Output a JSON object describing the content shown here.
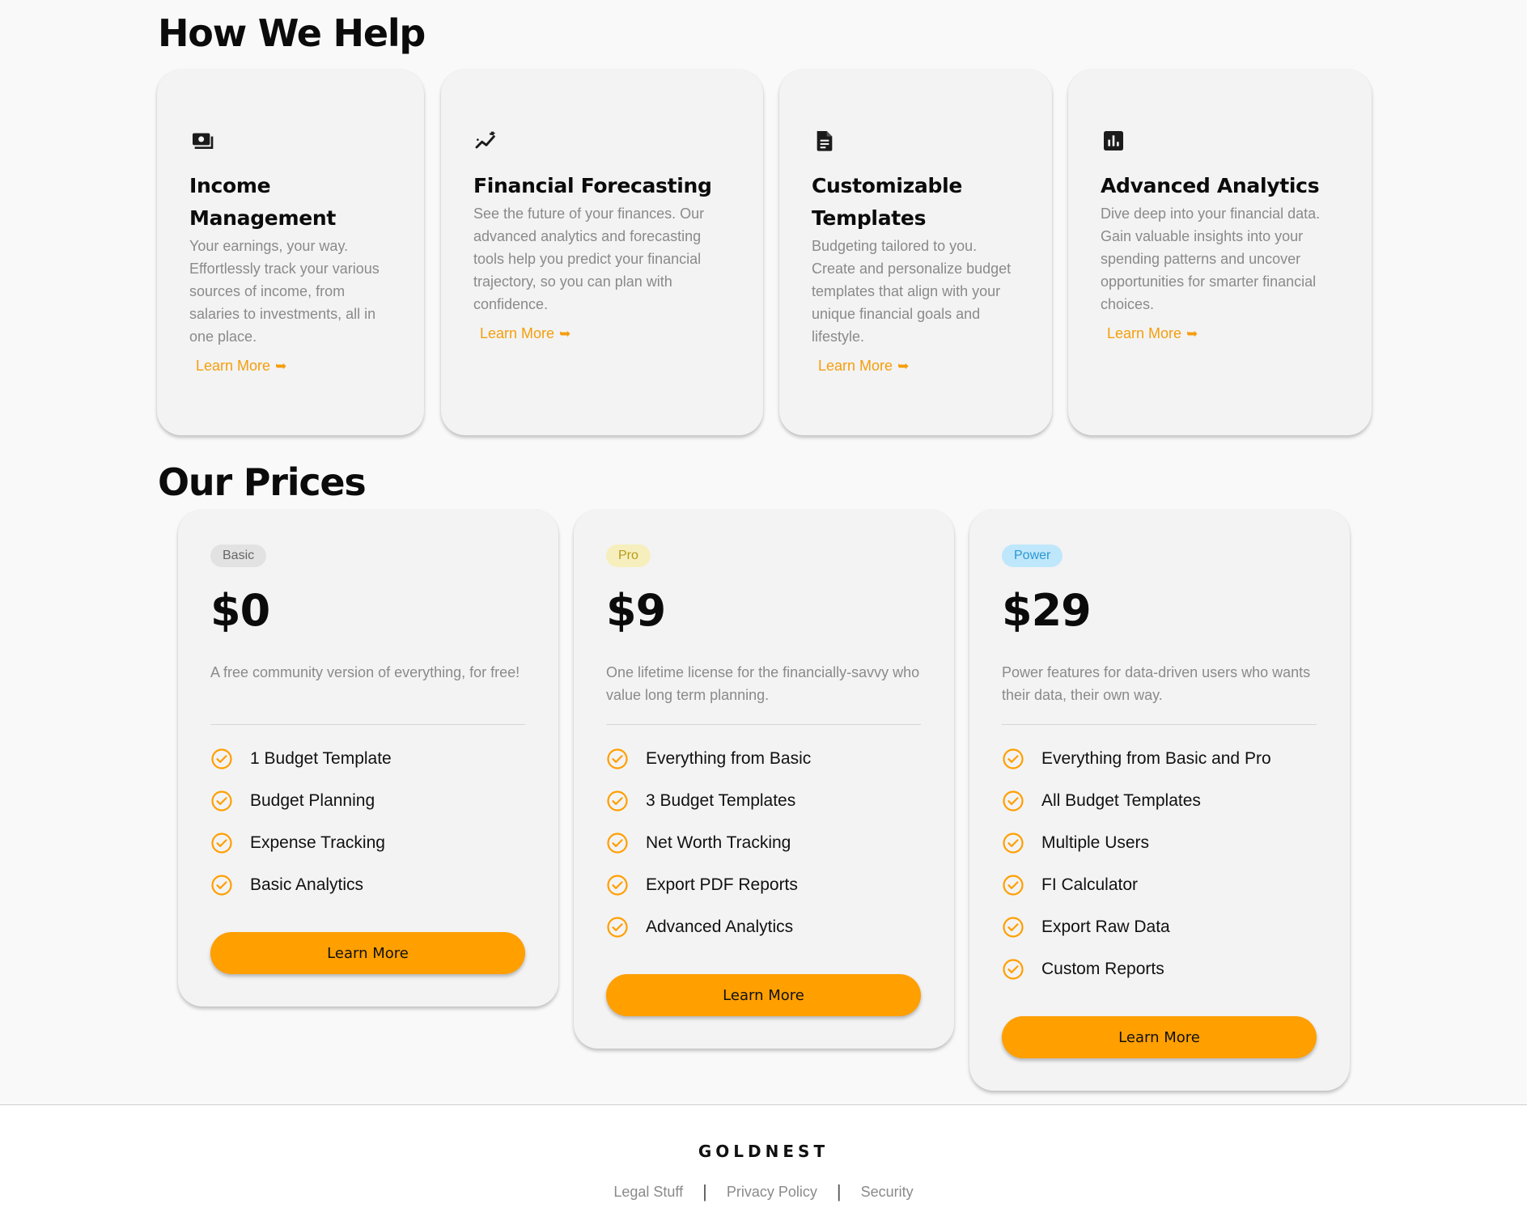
{
  "help": {
    "title": "How We Help",
    "cards": [
      {
        "icon": "money-icon",
        "title": "Income Management",
        "description": "Your earnings, your way. Effortlessly track your various sources of income, from salaries to investments, all in one place.",
        "link": "Learn More"
      },
      {
        "icon": "trending-icon",
        "title": "Financial Forecasting",
        "description": "See the future of your finances. Our advanced analytics and forecasting tools help you predict your financial trajectory, so you can plan with confidence.",
        "link": "Learn More"
      },
      {
        "icon": "document-icon",
        "title": "Customizable Templates",
        "description": "Budgeting tailored to you. Create and personalize budget templates that align with your unique financial goals and lifestyle.",
        "link": "Learn More"
      },
      {
        "icon": "analytics-icon",
        "title": "Advanced Analytics",
        "description": "Dive deep into your financial data. Gain valuable insights into your spending patterns and uncover opportunities for smarter financial choices.",
        "link": "Learn More"
      }
    ],
    "link_arrow": "➥"
  },
  "prices": {
    "title": "Our Prices",
    "plans": [
      {
        "badge": "Basic",
        "badge_bg": "#e2e2e2",
        "badge_color": "#666666",
        "price": "$0",
        "description": "A free community version of everything, for free!",
        "features": [
          "1 Budget Template",
          "Budget Planning",
          "Expense Tracking",
          "Basic Analytics"
        ],
        "cta": "Learn More"
      },
      {
        "badge": "Pro",
        "badge_bg": "#f6efbd",
        "badge_color": "#b89a1a",
        "price": "$9",
        "description": "One lifetime license for the financially-savvy who value long term planning.",
        "features": [
          "Everything from Basic",
          "3 Budget Templates",
          "Net Worth Tracking",
          "Export PDF Reports",
          "Advanced Analytics"
        ],
        "cta": "Learn More"
      },
      {
        "badge": "Power",
        "badge_bg": "#bfe7fb",
        "badge_color": "#2b97d4",
        "price": "$29",
        "description": "Power features for data-driven users who wants their data, their own way.",
        "features": [
          "Everything from Basic and Pro",
          "All Budget Templates",
          "Multiple Users",
          "FI Calculator",
          "Export Raw Data",
          "Custom Reports"
        ],
        "cta": "Learn More"
      }
    ]
  },
  "footer": {
    "brand": "GOLDNEST",
    "links": [
      "Legal Stuff",
      "Privacy Policy",
      "Security"
    ]
  },
  "colors": {
    "accent": "#ff9f00",
    "link": "#f59e0b",
    "muted_text": "#8a8a8a",
    "card_bg": "#f3f3f3"
  }
}
